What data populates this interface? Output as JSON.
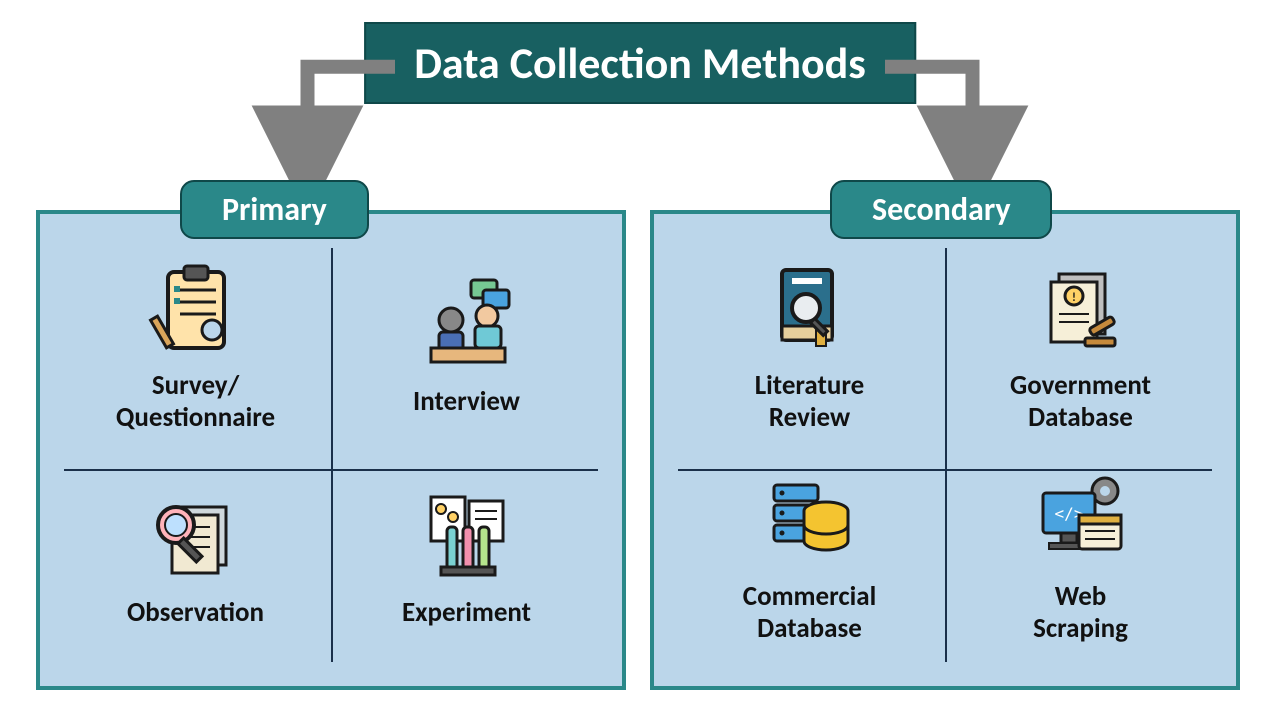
{
  "title": "Data Collection Methods",
  "categories": {
    "primary": {
      "label": "Primary",
      "items": [
        {
          "label": "Survey/\nQuestionnaire",
          "icon": "clipboard-icon"
        },
        {
          "label": "Interview",
          "icon": "interview-icon"
        },
        {
          "label": "Observation",
          "icon": "magnifier-icon"
        },
        {
          "label": "Experiment",
          "icon": "experiment-icon"
        }
      ]
    },
    "secondary": {
      "label": "Secondary",
      "items": [
        {
          "label": "Literature\nReview",
          "icon": "book-icon"
        },
        {
          "label": "Government\nDatabase",
          "icon": "document-gavel-icon"
        },
        {
          "label": "Commercial\nDatabase",
          "icon": "server-database-icon"
        },
        {
          "label": "Web\nScraping",
          "icon": "web-scraping-icon"
        }
      ]
    }
  },
  "colors": {
    "title_bg": "#186061",
    "pill_bg": "#2a8889",
    "panel_bg": "#bbd6ea",
    "panel_border": "#2a8889",
    "arrow": "#808080"
  }
}
